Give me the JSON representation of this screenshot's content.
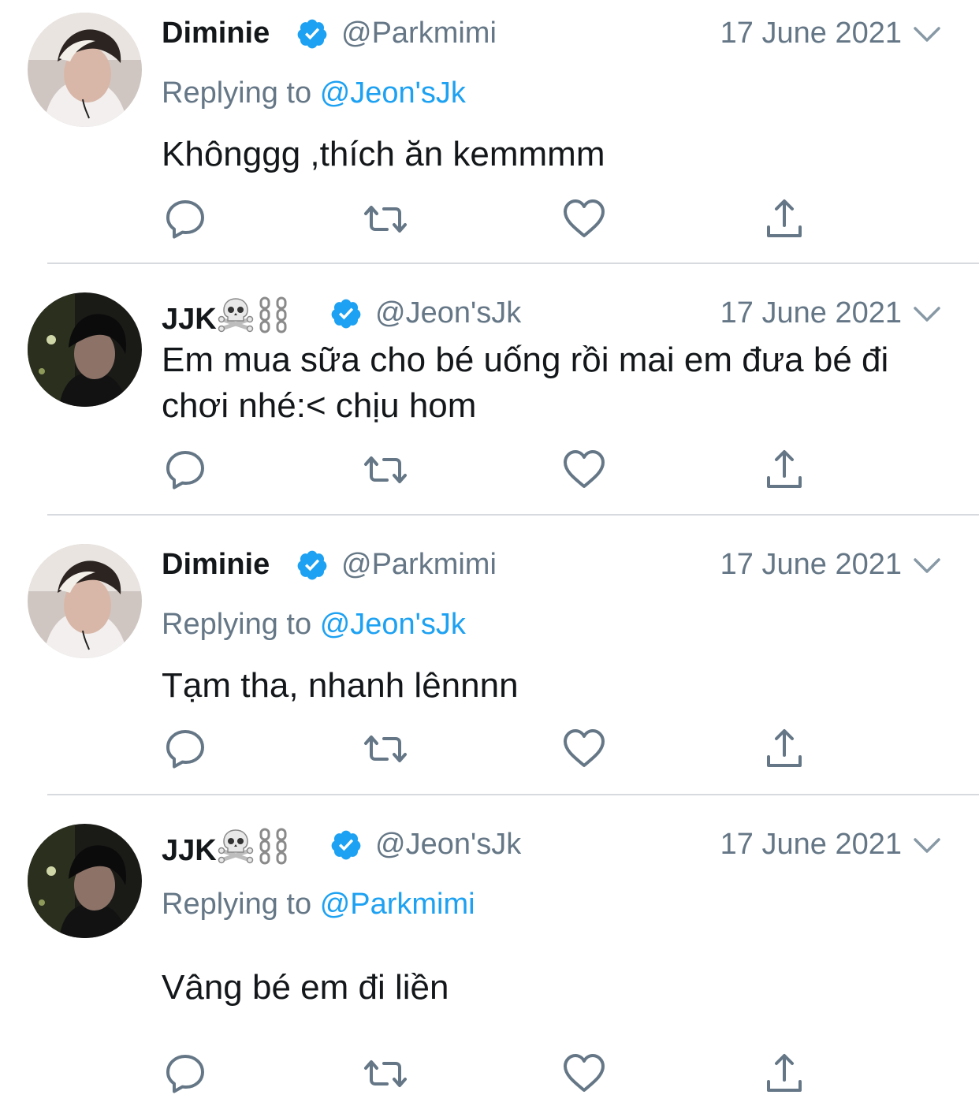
{
  "colors": {
    "text": "#14171a",
    "secondary": "#657786",
    "accent": "#1da1f2",
    "divider": "#d7dbdf"
  },
  "tweets": [
    {
      "name": "Diminie",
      "handle": "@Parkmimi",
      "date": "17 June 2021",
      "replying_prefix": "Replying to",
      "replying_to": "@Jeon'sJk",
      "text": "Khônggg ,thích ăn kemmmm",
      "avatar_icon": "avatar-light-hair",
      "verified_icon": "verified-badge-icon"
    },
    {
      "name": "JJK",
      "name_emoji": [
        "skull-crossbones-icon",
        "chains-icon"
      ],
      "handle": "@Jeon'sJk",
      "date": "17 June 2021",
      "text": "Em mua sữa cho bé uống rồi mai em đưa bé đi chơi nhé:< chịu hom",
      "avatar_icon": "avatar-dark-hair",
      "verified_icon": "verified-badge-icon"
    },
    {
      "name": "Diminie",
      "handle": "@Parkmimi",
      "date": "17 June 2021",
      "replying_prefix": "Replying to",
      "replying_to": "@Jeon'sJk",
      "text": "Tạm tha, nhanh lênnnn",
      "avatar_icon": "avatar-light-hair",
      "verified_icon": "verified-badge-icon"
    },
    {
      "name": "JJK",
      "name_emoji": [
        "skull-crossbones-icon",
        "chains-icon"
      ],
      "handle": "@Jeon'sJk",
      "date": "17 June 2021",
      "replying_prefix": "Replying to",
      "replying_to": "@Parkmimi",
      "text": "Vâng bé em đi liền",
      "avatar_icon": "avatar-dark-hair",
      "verified_icon": "verified-badge-icon"
    }
  ],
  "action_icons": [
    "reply-icon",
    "retweet-icon",
    "like-icon",
    "share-icon"
  ]
}
